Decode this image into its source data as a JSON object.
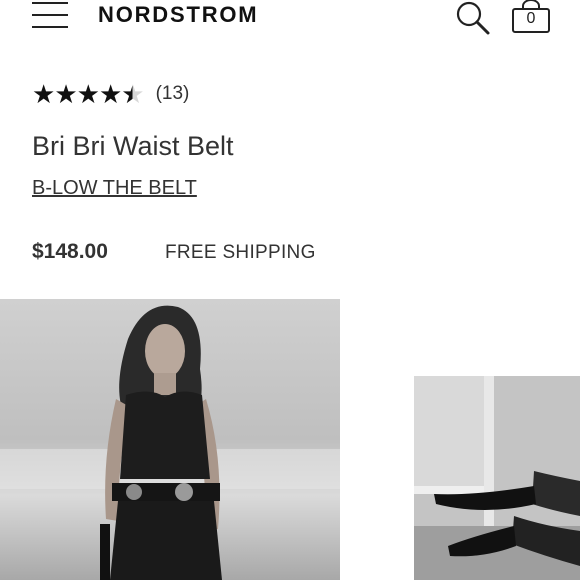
{
  "header": {
    "logo": "NORDSTROM",
    "bag_count": "0",
    "icons": [
      "menu-icon",
      "search-icon",
      "shopping-bag-icon"
    ]
  },
  "product": {
    "rating": 4.5,
    "review_count": "(13)",
    "title": "Bri Bri Waist Belt",
    "brand": "B-LOW THE BELT",
    "price": "$148.00",
    "shipping": "FREE SHIPPING"
  },
  "gallery": {
    "images": [
      "model-wearing-belt-photo",
      "model-legs-heels-photo"
    ]
  },
  "colors": {
    "text": "#333333",
    "star_filled": "#111111",
    "star_empty": "#d8d8d8"
  }
}
